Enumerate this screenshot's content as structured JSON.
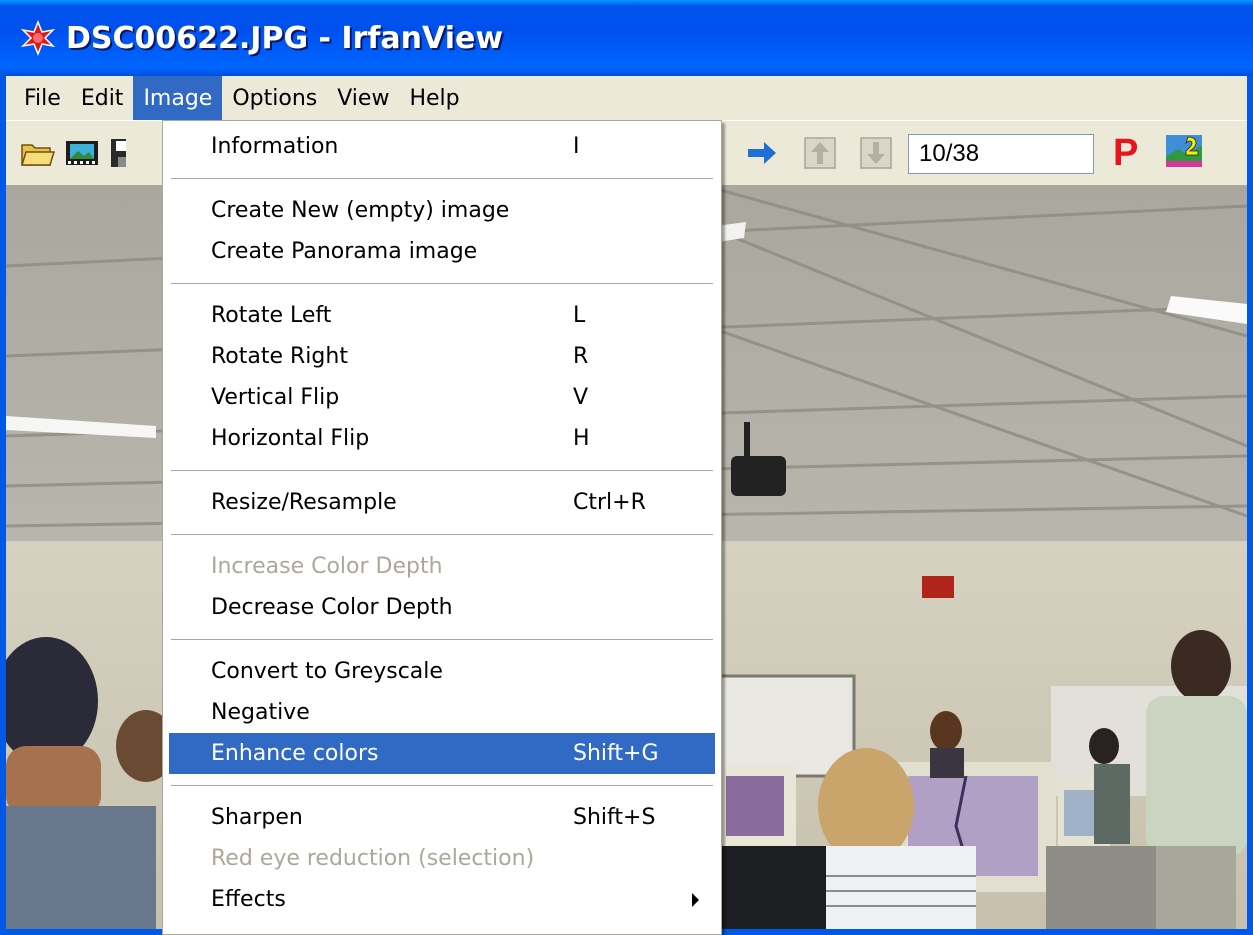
{
  "window": {
    "title": "DSC00622.JPG - IrfanView",
    "app_icon": "irfanview-cat-icon"
  },
  "menubar": {
    "items": [
      {
        "label": "File"
      },
      {
        "label": "Edit"
      },
      {
        "label": "Image",
        "active": true
      },
      {
        "label": "Options"
      },
      {
        "label": "View"
      },
      {
        "label": "Help"
      }
    ]
  },
  "toolbar": {
    "icons": [
      "open-folder-icon",
      "slideshow-icon",
      "save-icon",
      "next-arrow-icon",
      "previous-file-icon",
      "next-file-icon",
      "paint-icon",
      "irfanview-2-icon"
    ],
    "page_counter": "10/38",
    "p_label": "P"
  },
  "image_menu": {
    "items": [
      {
        "label": "Information",
        "shortcut": "I"
      },
      {
        "label": "Create New (empty) image",
        "shortcut": ""
      },
      {
        "label": "Create Panorama image",
        "shortcut": ""
      },
      {
        "label": "Rotate Left",
        "shortcut": "L"
      },
      {
        "label": "Rotate Right",
        "shortcut": "R"
      },
      {
        "label": "Vertical Flip",
        "shortcut": "V"
      },
      {
        "label": "Horizontal Flip",
        "shortcut": "H"
      },
      {
        "label": "Resize/Resample",
        "shortcut": "Ctrl+R"
      },
      {
        "label": "Increase Color Depth",
        "shortcut": "",
        "disabled": true
      },
      {
        "label": "Decrease Color Depth",
        "shortcut": ""
      },
      {
        "label": "Convert to Greyscale",
        "shortcut": ""
      },
      {
        "label": "Negative",
        "shortcut": ""
      },
      {
        "label": "Enhance colors",
        "shortcut": "Shift+G",
        "highlighted": true
      },
      {
        "label": "Sharpen",
        "shortcut": "Shift+S"
      },
      {
        "label": "Red eye reduction (selection)",
        "shortcut": "",
        "disabled": true
      },
      {
        "label": "Effects",
        "shortcut": "",
        "submenu": true
      }
    ]
  },
  "colors": {
    "titlebar": "#0053ee",
    "menu_highlight": "#316ac5",
    "menu_bg": "#ece9d8",
    "disabled_text": "#aca899"
  }
}
